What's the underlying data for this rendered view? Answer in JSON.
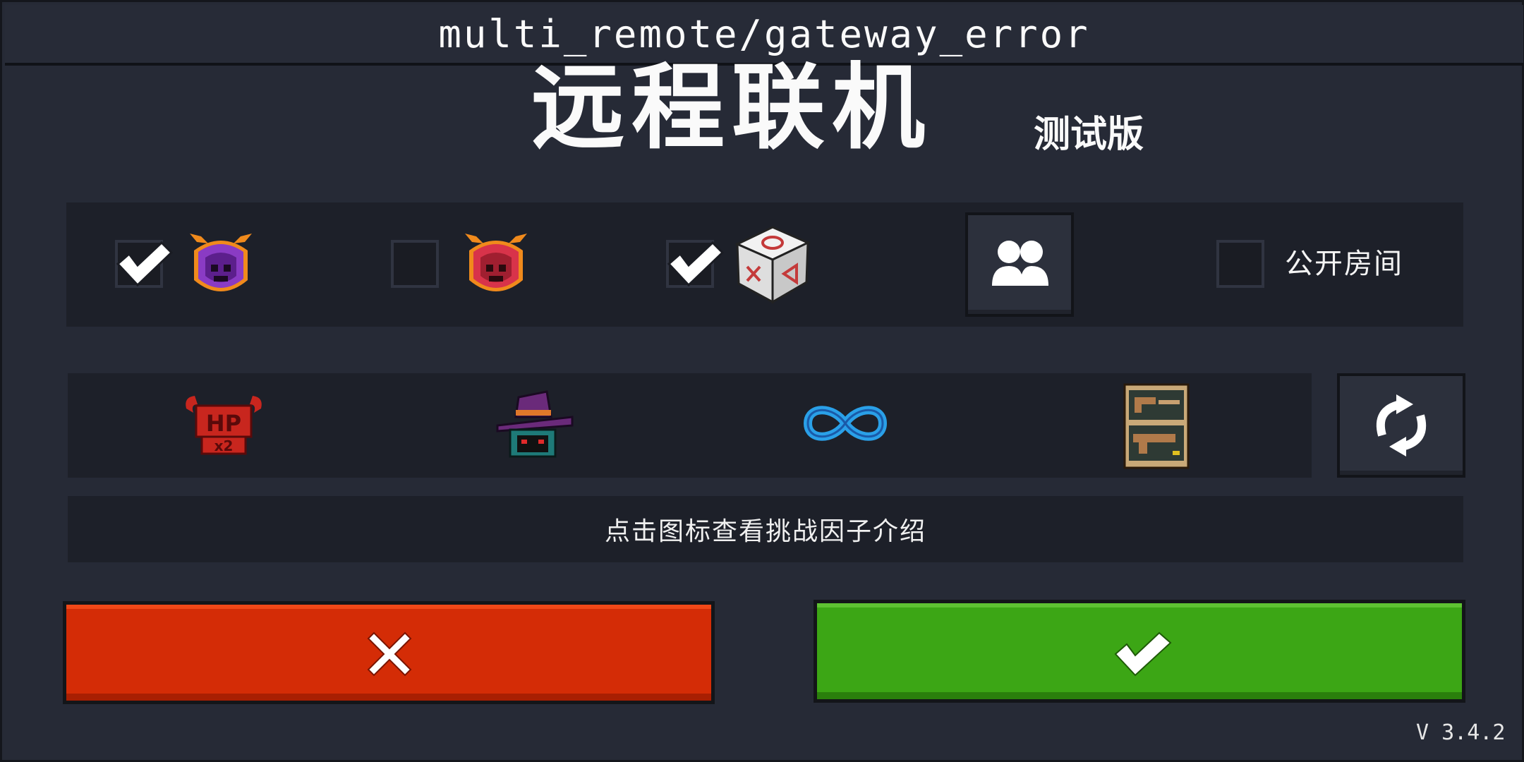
{
  "header": {
    "path": "multi_remote/gateway_error"
  },
  "title": {
    "main": "远程联机",
    "sub": "测试版"
  },
  "options_row": {
    "items": [
      {
        "icon": "purple-demon-mask-icon",
        "checked": true
      },
      {
        "icon": "red-demon-mask-icon",
        "checked": false
      },
      {
        "icon": "dice-icon",
        "checked": true
      }
    ],
    "friends_button_icon": "two-people-icon",
    "public_room": {
      "label": "公开房间",
      "checked": false
    }
  },
  "factors_row": {
    "icons": [
      "hp-x2-horned-icon",
      "wizard-hat-icon",
      "infinity-icon",
      "weapon-rack-icon"
    ],
    "refresh_icon": "refresh-arrows-icon"
  },
  "hint": {
    "text": "点击图标查看挑战因子介绍"
  },
  "actions": {
    "cancel_icon": "x-icon",
    "confirm_icon": "check-icon"
  },
  "footer": {
    "version": "V 3.4.2"
  },
  "colors": {
    "cancel": "#d42c06",
    "confirm": "#3ca615",
    "background": "#262a36",
    "panel": "#1d2029"
  }
}
